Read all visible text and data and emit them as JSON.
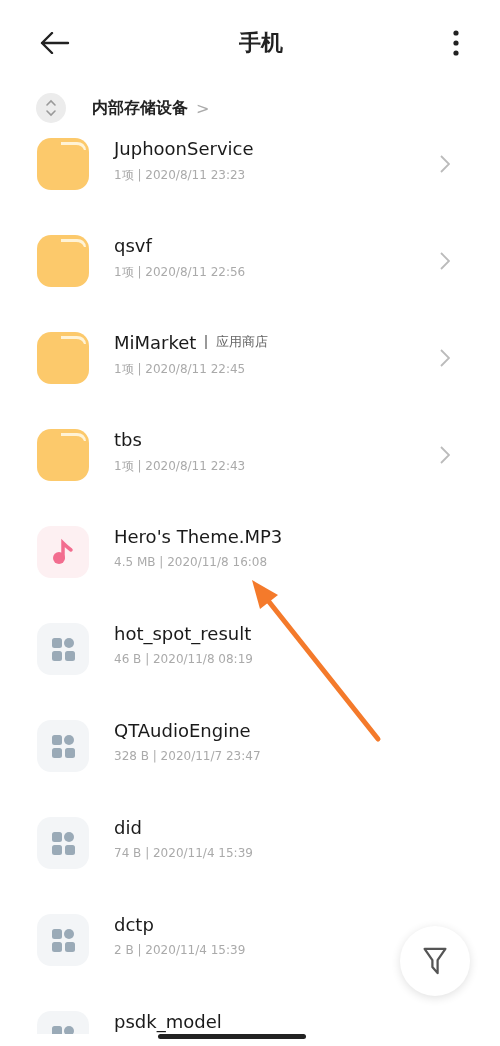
{
  "header": {
    "title": "手机"
  },
  "breadcrumb": {
    "label": "内部存储设备",
    "chevron": ">"
  },
  "files": [
    {
      "kind": "folder",
      "name": "JuphoonService",
      "meta": "1项 | 2020/8/11 23:23"
    },
    {
      "kind": "folder",
      "name": "qsvf",
      "meta": "1项 | 2020/8/11 22:56"
    },
    {
      "kind": "folder",
      "name": "MiMarket",
      "tag": "应用商店",
      "meta": "1项 | 2020/8/11 22:45"
    },
    {
      "kind": "folder",
      "name": "tbs",
      "meta": "1项 | 2020/8/11 22:43"
    },
    {
      "kind": "audio",
      "name": "Hero's Theme.MP3",
      "meta": "4.5 MB | 2020/11/8 16:08"
    },
    {
      "kind": "file",
      "name": "hot_spot_result",
      "meta": "46 B | 2020/11/8 08:19"
    },
    {
      "kind": "file",
      "name": "QTAudioEngine",
      "meta": "328 B | 2020/11/7 23:47"
    },
    {
      "kind": "file",
      "name": "did",
      "meta": "74 B | 2020/11/4 15:39"
    },
    {
      "kind": "file",
      "name": "dctp",
      "meta": "2 B | 2020/11/4 15:39"
    },
    {
      "kind": "file",
      "name": "psdk_model"
    }
  ]
}
